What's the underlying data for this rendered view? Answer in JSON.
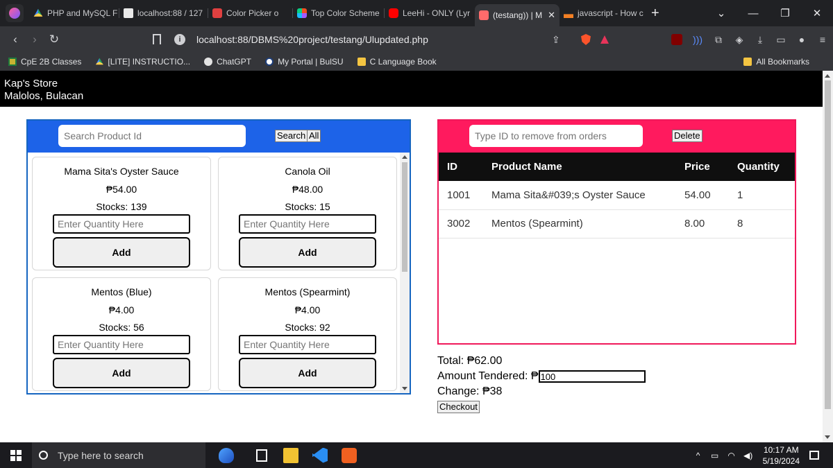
{
  "browser": {
    "tabs": [
      {
        "label": "PHP and MySQL F",
        "icon": "google-drive-icon"
      },
      {
        "label": "localhost:88 / 127",
        "icon": "phpmyadmin-icon"
      },
      {
        "label": "Color Picker o",
        "icon": "color-picker-icon"
      },
      {
        "label": "Top Color Scheme",
        "icon": "figma-icon"
      },
      {
        "label": "LeeHi - ONLY (Lyr",
        "icon": "youtube-icon"
      },
      {
        "label": "(testang)) | M",
        "icon": "tab-app-icon",
        "active": true
      },
      {
        "label": "javascript - How c",
        "icon": "stackoverflow-icon"
      }
    ],
    "url": "localhost:88/DBMS%20project/testang/Ulupdated.php",
    "bookmarks": [
      "CpE 2B Classes",
      "[LITE] INSTRUCTIO...",
      "ChatGPT",
      "My Portal | BulSU",
      "C Language Book"
    ],
    "all_bookmarks": "All Bookmarks"
  },
  "store": {
    "name": "Kap's Store",
    "location": "Malolos, Bulacan"
  },
  "products_panel": {
    "search_placeholder": "Search Product Id",
    "search_label": "Search",
    "all_label": "All",
    "qty_placeholder": "Enter Quantity Here",
    "add_label": "Add",
    "products": [
      {
        "name": "Mama Sita's Oyster Sauce",
        "price": "₱54.00",
        "stock": "Stocks: 139"
      },
      {
        "name": "Canola Oil",
        "price": "₱48.00",
        "stock": "Stocks: 15"
      },
      {
        "name": "Mentos (Blue)",
        "price": "₱4.00",
        "stock": "Stocks: 56"
      },
      {
        "name": "Mentos (Spearmint)",
        "price": "₱4.00",
        "stock": "Stocks: 92"
      }
    ]
  },
  "orders_panel": {
    "remove_placeholder": "Type ID to remove from orders",
    "delete_label": "Delete",
    "headers": {
      "id": "ID",
      "name": "Product Name",
      "price": "Price",
      "qty": "Quantity"
    },
    "rows": [
      {
        "id": "1001",
        "name": "Mama Sita&#039;s Oyster Sauce",
        "price": "54.00",
        "qty": "1"
      },
      {
        "id": "3002",
        "name": "Mentos (Spearmint)",
        "price": "8.00",
        "qty": "8"
      }
    ]
  },
  "summary": {
    "total_label": "Total: ",
    "total": "₱62.00",
    "tendered_label": "Amount Tendered: ₱",
    "tendered_value": "100",
    "change_label": "Change: ",
    "change": "₱38",
    "checkout_label": "Checkout"
  },
  "taskbar": {
    "search_placeholder": "Type here to search",
    "time": "10:17 AM",
    "date": "5/19/2024"
  }
}
